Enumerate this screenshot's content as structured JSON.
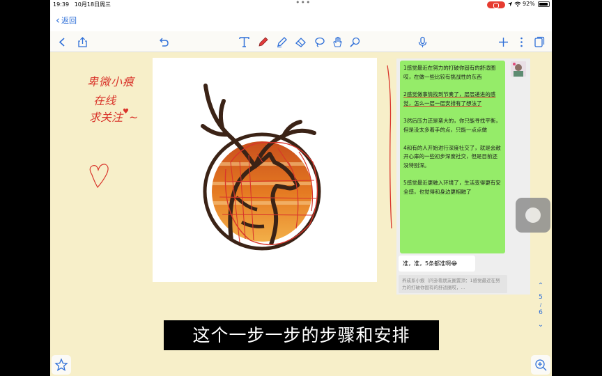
{
  "status_bar": {
    "time": "19:39",
    "date": "10月18日周三",
    "battery": "92%",
    "battery_level": 0.92
  },
  "nav": {
    "back_label": "返回"
  },
  "toolbar": {
    "icons": [
      "chevron-left-icon",
      "share-icon",
      "undo-icon",
      "text-icon",
      "pen-icon",
      "highlighter-icon",
      "eraser-icon",
      "lasso-icon",
      "hand-icon",
      "magic-icon",
      "microphone-icon",
      "plus-icon",
      "more-icon",
      "pages-icon"
    ]
  },
  "handwriting": {
    "line1": "卑微小痕",
    "line2": "在线",
    "line3": "求关注",
    "symbol": "~"
  },
  "chat": {
    "messages": [
      "1感觉最近在努力的打破你固有的舒适圈哎，在做一些比较有挑战性的东西",
      "2感觉做事情找到节奏了，层层递进的感觉，怎么一层一层安排有了想法了",
      "3然后压力还是蛮大的，你只能寻找平衡，但是没太多着手的点，只能一点点做",
      "4和有的人开始进行深度社交了，就是会敞开心扉的一些初步深度社交，但是目前还没特别深。",
      "5感觉最近更融入环境了，生活变得更有安全感，也觉得和身边更相融了"
    ],
    "reply": "准，准，5条都准啊😂",
    "quote": "养成系小痕（问卦看朋友圈置顶：1感觉最近在努力的打破你固有的舒适圈哎，..."
  },
  "pager": {
    "current": "5",
    "separator": "/",
    "total": "6"
  },
  "subtitle": "这个一步一步的步骤和安排",
  "colors": {
    "accent": "#2e6fd8",
    "ink_red": "#d9352b",
    "bubble_green": "#95ec69",
    "paper": "#f7efc9"
  }
}
